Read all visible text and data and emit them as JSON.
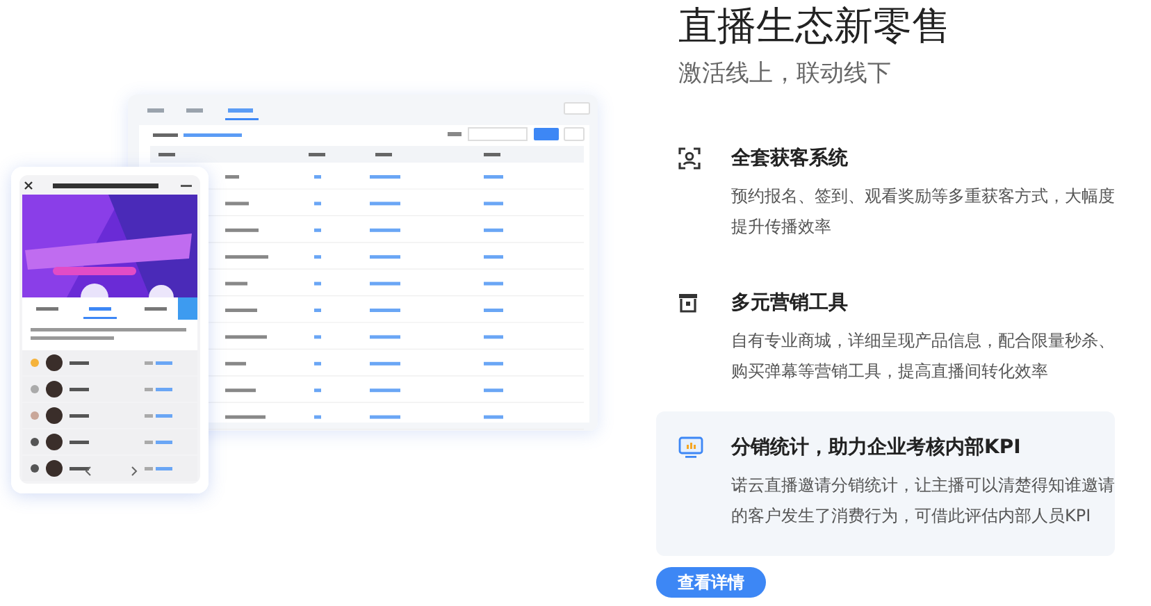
{
  "heading": "直播生态新零售",
  "subheading": "激活线上，联动线下",
  "features": [
    {
      "kind": "scan",
      "title": "全套获客系统",
      "description": "预约报名、签到、观看奖励等多重获客方式，大幅度提升传播效率",
      "selected": false
    },
    {
      "kind": "store",
      "title": "多元营销工具",
      "description": "自有专业商城，详细呈现产品信息，配合限量秒杀、购买弹幕等营销工具，提高直播间转化效率",
      "selected": false
    },
    {
      "kind": "stats",
      "title": "分销统计，助力企业考核内部KPI",
      "description": "诺云直播邀请分销统计，让主播可以清楚得知谁邀请的客户发生了消费行为，可借此评估内部人员KPI",
      "selected": true
    }
  ],
  "button": "查看详情"
}
